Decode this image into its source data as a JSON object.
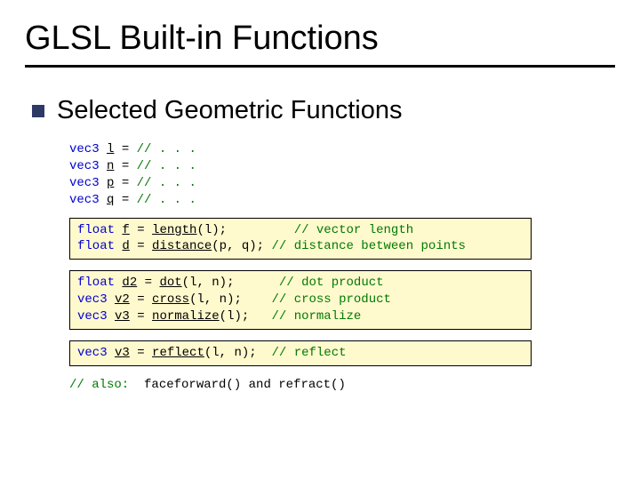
{
  "title": "GLSL Built-in Functions",
  "bullet": "Selected Geometric Functions",
  "decl": {
    "kw": "vec3",
    "l": "l",
    "n": "n",
    "p": "p",
    "q": "q",
    "eq": " = ",
    "cmt": "// . . ."
  },
  "box1": {
    "floatkw": "float",
    "f": "f",
    "d": "d",
    "eq": " = ",
    "length": "length",
    "lparen_l": "(l);",
    "distance": "distance",
    "distargs": "(p, q);",
    "c1": "// vector length",
    "c2": "// distance between points"
  },
  "box2": {
    "floatkw": "float",
    "vec3kw": "vec3",
    "d2": "d2",
    "v2": "v2",
    "v3": "v3",
    "eq": " = ",
    "dot": "dot",
    "dotargs": "(l, n);",
    "cross": "cross",
    "crossargs": "(l, n);",
    "normalize": "normalize",
    "normargs": "(l);",
    "c1": "// dot product",
    "c2": "// cross product",
    "c3": "// normalize"
  },
  "box3": {
    "vec3kw": "vec3",
    "v3": "v3",
    "eq": " = ",
    "reflect": "reflect",
    "refargs": "(l, n);",
    "c1": "// reflect"
  },
  "tail": {
    "c": "// also:",
    "rest": "  faceforward() and refract()"
  }
}
